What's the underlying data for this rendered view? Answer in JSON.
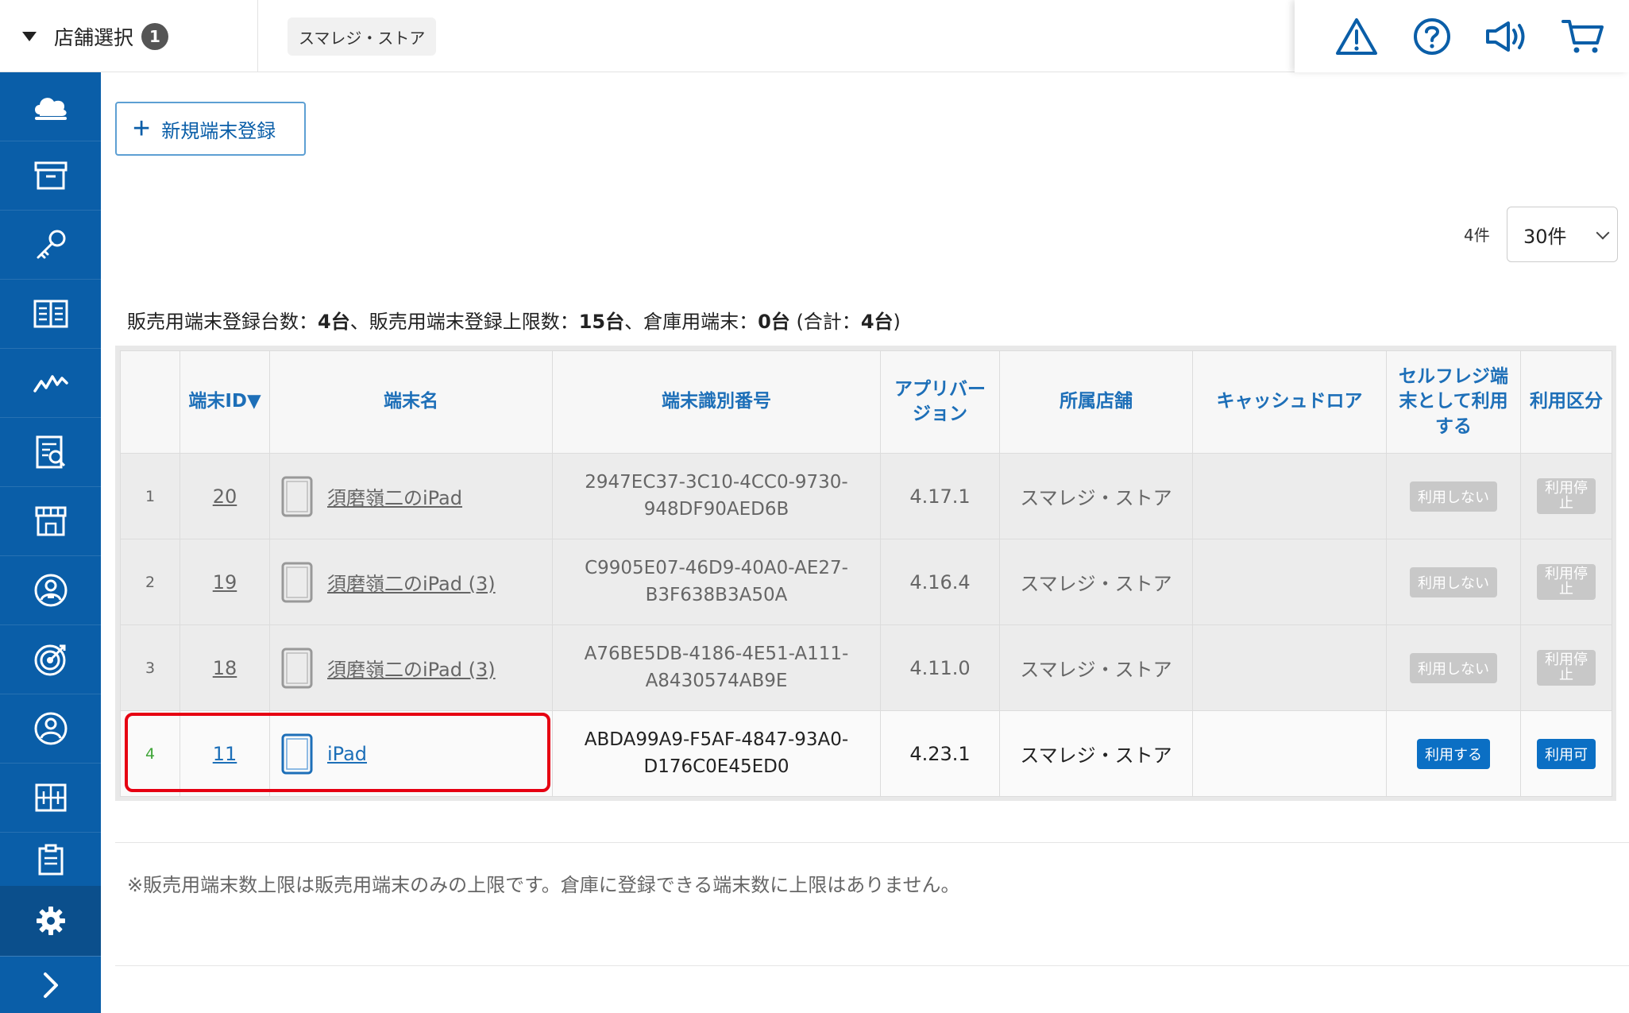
{
  "header": {
    "store_select_label": "店舗選択",
    "store_select_badge": "1",
    "current_store": "スマレジ・ストア",
    "icons": [
      "warning-icon",
      "help-icon",
      "megaphone-icon",
      "cart-icon"
    ]
  },
  "sidebar": {
    "items": [
      "cloud-icon",
      "archive-icon",
      "key-icon",
      "book-icon",
      "chart-icon",
      "report-icon",
      "store-icon",
      "staff-icon",
      "target-icon",
      "customer-icon",
      "grid-icon",
      "clipboard-icon"
    ],
    "settings_icon": "gear-icon",
    "expand_icon": "chevron-right-icon"
  },
  "toolbar": {
    "new_button_plus": "+",
    "new_button_label": "新規端末登録",
    "count": "4件",
    "per_page": "30件"
  },
  "summary": {
    "part1": "販売用端末登録台数：",
    "v1": "4台",
    "part2": "、販売用端末登録上限数：",
    "v2": "15台",
    "part3": "、倉庫用端末：",
    "v3": "0台",
    "part4": " (合計：",
    "v4": "4台",
    "part5": ")"
  },
  "table": {
    "headers": [
      "",
      "端末ID▼",
      "端末名",
      "端末識別番号",
      "アプリバージョン",
      "所属店舗",
      "キャッシュドロア",
      "セルフレジ端末として利用する",
      "利用区分"
    ],
    "rows": [
      {
        "idx": "1",
        "id": "20",
        "name": "須磨嶺二のiPad",
        "udid1": "2947EC37-3C10-4CC0-9730-",
        "udid2": "948DF90AED6B",
        "version": "4.17.1",
        "store": "スマレジ・ストア",
        "drawer": "",
        "self": "利用しない",
        "status": "利用停止"
      },
      {
        "idx": "2",
        "id": "19",
        "name": "須磨嶺二のiPad (3)",
        "udid1": "C9905E07-46D9-40A0-AE27-",
        "udid2": "B3F638B3A50A",
        "version": "4.16.4",
        "store": "スマレジ・ストア",
        "drawer": "",
        "self": "利用しない",
        "status": "利用停止"
      },
      {
        "idx": "3",
        "id": "18",
        "name": "須磨嶺二のiPad (3)",
        "udid1": "A76BE5DB-4186-4E51-A111-",
        "udid2": "A8430574AB9E",
        "version": "4.11.0",
        "store": "スマレジ・ストア",
        "drawer": "",
        "self": "利用しない",
        "status": "利用停止"
      },
      {
        "idx": "4",
        "id": "11",
        "name": "iPad",
        "udid1": "ABDA99A9-F5AF-4847-93A0-",
        "udid2": "D176C0E45ED0",
        "version": "4.23.1",
        "store": "スマレジ・ストア",
        "drawer": "",
        "self": "利用する",
        "status": "利用可"
      }
    ]
  },
  "footer_note": "※販売用端末数上限は販売用端末のみの上限です。倉庫に登録できる端末数に上限はありません。",
  "colors": {
    "sidebar": "#0a5ea8",
    "accent": "#1d6fb8",
    "highlight": "#e60012",
    "active_pill": "#0b6fc4"
  }
}
